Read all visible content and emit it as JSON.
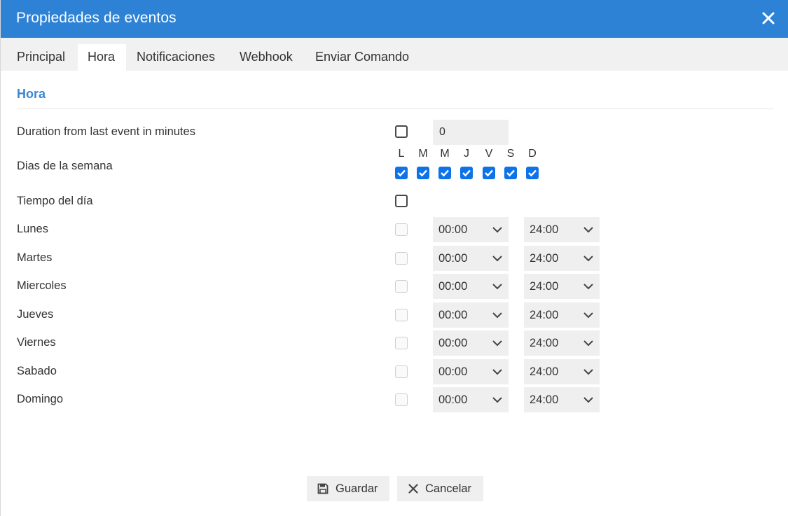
{
  "dialog": {
    "title": "Propiedades de eventos"
  },
  "tabs": [
    {
      "label": "Principal",
      "active": false
    },
    {
      "label": "Hora",
      "active": true
    },
    {
      "label": "Notificaciones",
      "active": false
    },
    {
      "label": "Webhook",
      "active": false
    },
    {
      "label": "Enviar Comando",
      "active": false
    }
  ],
  "section": {
    "title": "Hora"
  },
  "duration": {
    "label": "Duration from last event in minutes",
    "checked": false,
    "value": "0"
  },
  "weekdays": {
    "label": "Dias de la semana",
    "letters": [
      "L",
      "M",
      "M",
      "J",
      "V",
      "S",
      "D"
    ],
    "checked": [
      true,
      true,
      true,
      true,
      true,
      true,
      true
    ]
  },
  "time_of_day": {
    "label": "Tiempo del día",
    "checked": false
  },
  "days": [
    {
      "label": "Lunes",
      "from": "00:00",
      "to": "24:00"
    },
    {
      "label": "Martes",
      "from": "00:00",
      "to": "24:00"
    },
    {
      "label": "Miercoles",
      "from": "00:00",
      "to": "24:00"
    },
    {
      "label": "Jueves",
      "from": "00:00",
      "to": "24:00"
    },
    {
      "label": "Viernes",
      "from": "00:00",
      "to": "24:00"
    },
    {
      "label": "Sabado",
      "from": "00:00",
      "to": "24:00"
    },
    {
      "label": "Domingo",
      "from": "00:00",
      "to": "24:00"
    }
  ],
  "buttons": {
    "save": "Guardar",
    "cancel": "Cancelar"
  },
  "colors": {
    "header": "#2d82d6",
    "accent": "#3a87d0",
    "checkbox": "#0f73e8"
  }
}
